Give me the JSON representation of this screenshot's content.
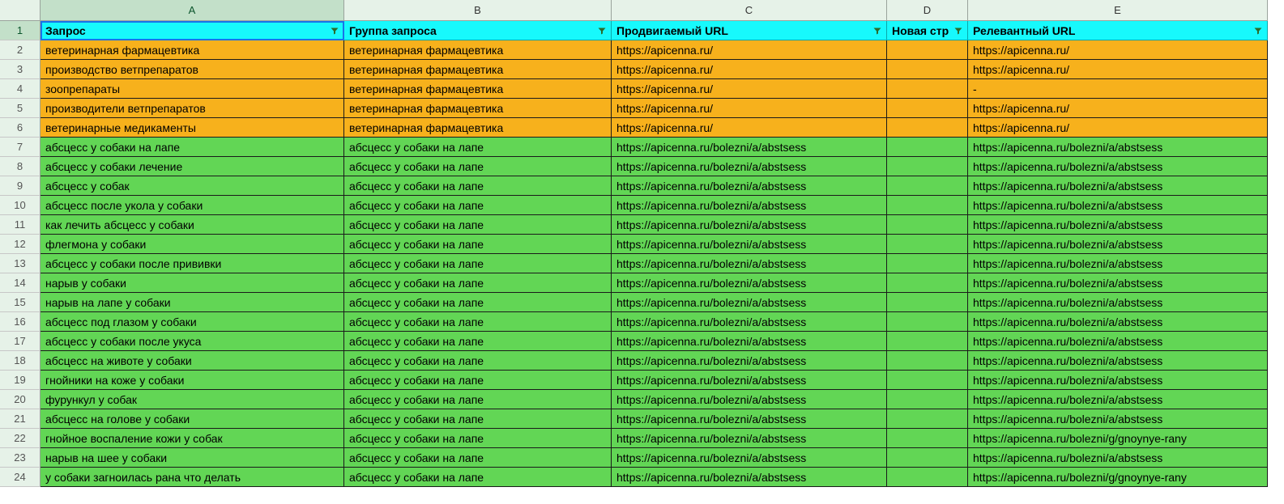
{
  "columns": [
    "A",
    "B",
    "C",
    "D",
    "E"
  ],
  "headers": {
    "A": "Запрос",
    "B": "Группа запроса",
    "C": "Продвигаемый URL",
    "D": "Новая стр",
    "E": "Релевантный URL"
  },
  "rows": [
    {
      "n": 2,
      "color": "orange",
      "A": "ветеринарная фармацевтика",
      "B": "ветеринарная фармацевтика",
      "C": "https://apicenna.ru/",
      "D": "",
      "E": "https://apicenna.ru/"
    },
    {
      "n": 3,
      "color": "orange",
      "A": "производство ветпрепаратов",
      "B": "ветеринарная фармацевтика",
      "C": "https://apicenna.ru/",
      "D": "",
      "E": "https://apicenna.ru/"
    },
    {
      "n": 4,
      "color": "orange",
      "A": "зоопрепараты",
      "B": "ветеринарная фармацевтика",
      "C": "https://apicenna.ru/",
      "D": "",
      "E": "-"
    },
    {
      "n": 5,
      "color": "orange",
      "A": "производители ветпрепаратов",
      "B": "ветеринарная фармацевтика",
      "C": "https://apicenna.ru/",
      "D": "",
      "E": "https://apicenna.ru/"
    },
    {
      "n": 6,
      "color": "orange",
      "A": "ветеринарные медикаменты",
      "B": "ветеринарная фармацевтика",
      "C": "https://apicenna.ru/",
      "D": "",
      "E": "https://apicenna.ru/"
    },
    {
      "n": 7,
      "color": "green",
      "A": "абсцесс у собаки на лапе",
      "B": "абсцесс у собаки на лапе",
      "C": "https://apicenna.ru/bolezni/a/abstsess",
      "D": "",
      "E": "https://apicenna.ru/bolezni/a/abstsess"
    },
    {
      "n": 8,
      "color": "green",
      "A": "абсцесс у собаки лечение",
      "B": "абсцесс у собаки на лапе",
      "C": "https://apicenna.ru/bolezni/a/abstsess",
      "D": "",
      "E": "https://apicenna.ru/bolezni/a/abstsess"
    },
    {
      "n": 9,
      "color": "green",
      "A": "абсцесс у собак",
      "B": "абсцесс у собаки на лапе",
      "C": "https://apicenna.ru/bolezni/a/abstsess",
      "D": "",
      "E": "https://apicenna.ru/bolezni/a/abstsess"
    },
    {
      "n": 10,
      "color": "green",
      "A": "абсцесс после укола у собаки",
      "B": "абсцесс у собаки на лапе",
      "C": "https://apicenna.ru/bolezni/a/abstsess",
      "D": "",
      "E": "https://apicenna.ru/bolezni/a/abstsess"
    },
    {
      "n": 11,
      "color": "green",
      "A": "как лечить абсцесс у собаки",
      "B": "абсцесс у собаки на лапе",
      "C": "https://apicenna.ru/bolezni/a/abstsess",
      "D": "",
      "E": "https://apicenna.ru/bolezni/a/abstsess"
    },
    {
      "n": 12,
      "color": "green",
      "A": "флегмона у собаки",
      "B": "абсцесс у собаки на лапе",
      "C": "https://apicenna.ru/bolezni/a/abstsess",
      "D": "",
      "E": "https://apicenna.ru/bolezni/a/abstsess"
    },
    {
      "n": 13,
      "color": "green",
      "A": "абсцесс у собаки после прививки",
      "B": "абсцесс у собаки на лапе",
      "C": "https://apicenna.ru/bolezni/a/abstsess",
      "D": "",
      "E": "https://apicenna.ru/bolezni/a/abstsess"
    },
    {
      "n": 14,
      "color": "green",
      "A": "нарыв у собаки",
      "B": "абсцесс у собаки на лапе",
      "C": "https://apicenna.ru/bolezni/a/abstsess",
      "D": "",
      "E": "https://apicenna.ru/bolezni/a/abstsess"
    },
    {
      "n": 15,
      "color": "green",
      "A": "нарыв на лапе у собаки",
      "B": "абсцесс у собаки на лапе",
      "C": "https://apicenna.ru/bolezni/a/abstsess",
      "D": "",
      "E": "https://apicenna.ru/bolezni/a/abstsess"
    },
    {
      "n": 16,
      "color": "green",
      "A": "абсцесс под глазом у собаки",
      "B": "абсцесс у собаки на лапе",
      "C": "https://apicenna.ru/bolezni/a/abstsess",
      "D": "",
      "E": "https://apicenna.ru/bolezni/a/abstsess"
    },
    {
      "n": 17,
      "color": "green",
      "A": "абсцесс у собаки после укуса",
      "B": "абсцесс у собаки на лапе",
      "C": "https://apicenna.ru/bolezni/a/abstsess",
      "D": "",
      "E": "https://apicenna.ru/bolezni/a/abstsess"
    },
    {
      "n": 18,
      "color": "green",
      "A": "абсцесс на животе у собаки",
      "B": "абсцесс у собаки на лапе",
      "C": "https://apicenna.ru/bolezni/a/abstsess",
      "D": "",
      "E": "https://apicenna.ru/bolezni/a/abstsess"
    },
    {
      "n": 19,
      "color": "green",
      "A": "гнойники на коже у собаки",
      "B": "абсцесс у собаки на лапе",
      "C": "https://apicenna.ru/bolezni/a/abstsess",
      "D": "",
      "E": "https://apicenna.ru/bolezni/a/abstsess"
    },
    {
      "n": 20,
      "color": "green",
      "A": "фурункул у собак",
      "B": "абсцесс у собаки на лапе",
      "C": "https://apicenna.ru/bolezni/a/abstsess",
      "D": "",
      "E": "https://apicenna.ru/bolezni/a/abstsess"
    },
    {
      "n": 21,
      "color": "green",
      "A": "абсцесс на голове у собаки",
      "B": "абсцесс у собаки на лапе",
      "C": "https://apicenna.ru/bolezni/a/abstsess",
      "D": "",
      "E": "https://apicenna.ru/bolezni/a/abstsess"
    },
    {
      "n": 22,
      "color": "green",
      "A": "гнойное воспаление кожи у собак",
      "B": "абсцесс у собаки на лапе",
      "C": "https://apicenna.ru/bolezni/a/abstsess",
      "D": "",
      "E": "https://apicenna.ru/bolezni/g/gnoynye-rany"
    },
    {
      "n": 23,
      "color": "green",
      "A": "нарыв на шее у собаки",
      "B": "абсцесс у собаки на лапе",
      "C": "https://apicenna.ru/bolezni/a/abstsess",
      "D": "",
      "E": "https://apicenna.ru/bolezni/a/abstsess"
    },
    {
      "n": 24,
      "color": "green",
      "A": "у собаки загноилась рана что делать",
      "B": "абсцесс у собаки на лапе",
      "C": "https://apicenna.ru/bolezni/a/abstsess",
      "D": "",
      "E": "https://apicenna.ru/bolezni/g/gnoynye-rany"
    }
  ]
}
